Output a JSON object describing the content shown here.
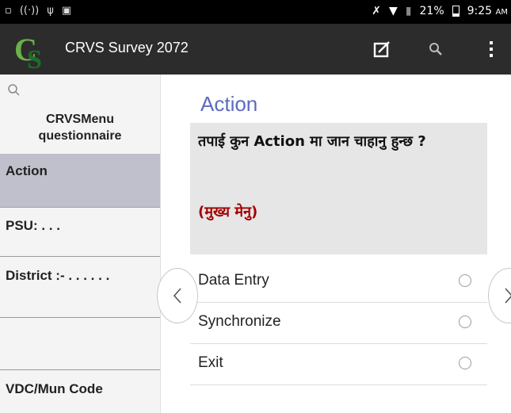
{
  "status_bar": {
    "battery_percent": "21%",
    "time": "9:25",
    "time_suffix": "AM"
  },
  "action_bar": {
    "app_title": "CRVS Survey 2072"
  },
  "drawer": {
    "header_line1": "CRVSMenu",
    "header_line2": "questionnaire",
    "items": [
      {
        "label": "Action"
      },
      {
        "label": "PSU: . . ."
      },
      {
        "label": "District :- . . . . . ."
      },
      {
        "label": "VDC/Mun Code"
      }
    ]
  },
  "main": {
    "title": "Action",
    "question": "तपाई कुन Action मा जान चाहानु हुन्छ ?",
    "hint": "(मुख्य मेनु)",
    "options": [
      {
        "label": "Data Entry"
      },
      {
        "label": "Synchronize"
      },
      {
        "label": "Exit"
      }
    ]
  },
  "colors": {
    "accent": "#5c6bc0",
    "hint": "#a30000",
    "active_item": "#c0c0cc"
  }
}
